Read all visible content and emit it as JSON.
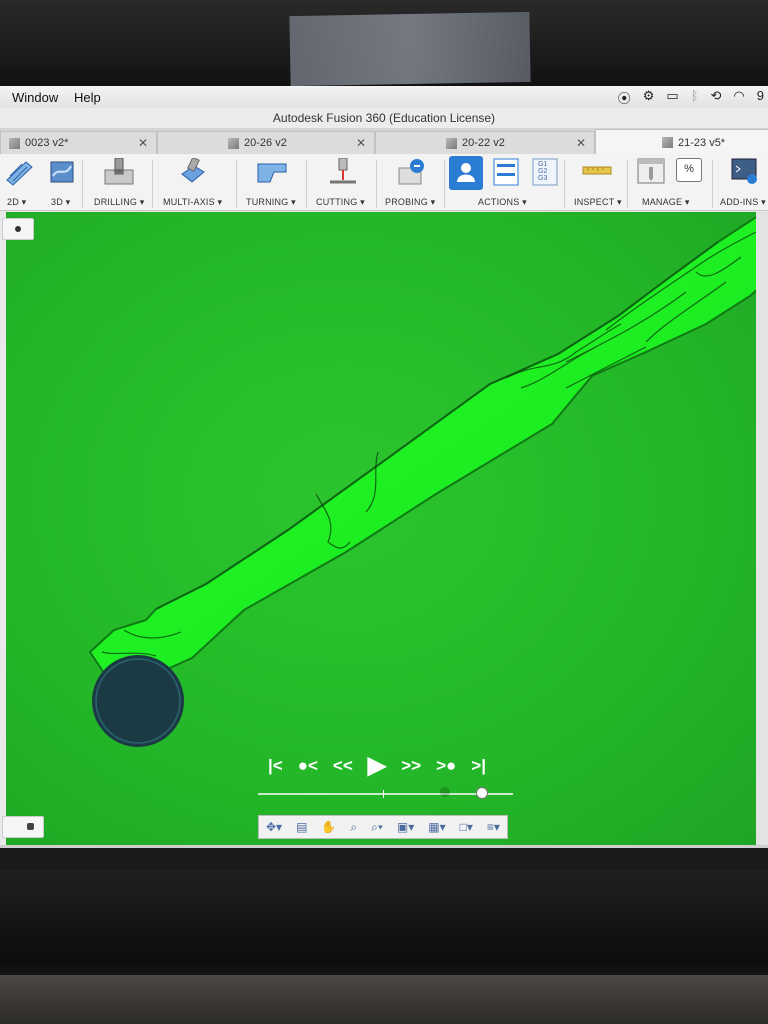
{
  "menubar": {
    "items": [
      "Window",
      "Help"
    ],
    "status_icons": [
      "creative-cloud-icon",
      "settings-icon",
      "airplay-icon",
      "bluetooth-icon",
      "time-machine-icon",
      "wifi-icon"
    ],
    "battery_text": "9"
  },
  "window": {
    "title": "Autodesk Fusion 360 (Education License)"
  },
  "tabs": [
    {
      "label": "0023 v2*",
      "active": false
    },
    {
      "label": "20-26 v2",
      "active": false
    },
    {
      "label": "20-22 v2",
      "active": false
    },
    {
      "label": "21-23 v5*",
      "active": true
    }
  ],
  "toolbar": {
    "groups": [
      "2D ▾",
      "3D ▾",
      "DRILLING ▾",
      "MULTI-AXIS ▾",
      "TURNING ▾",
      "CUTTING ▾",
      "PROBING ▾",
      "ACTIONS ▾",
      "INSPECT ▾",
      "MANAGE ▾",
      "ADD-INS ▾"
    ],
    "nc_code_lines": [
      "G1",
      "G2",
      "G3"
    ],
    "percent_symbol": "%"
  },
  "playback": {
    "buttons": [
      "|<",
      "●<",
      "<<",
      "▶",
      ">>",
      ">●",
      ">|"
    ],
    "progress": 0.88,
    "marker": 0.49
  },
  "colors": {
    "viewport": "#24b829",
    "stock": "#19f21f",
    "tool": "#1c3a44",
    "accent": "#2b7cd3"
  }
}
